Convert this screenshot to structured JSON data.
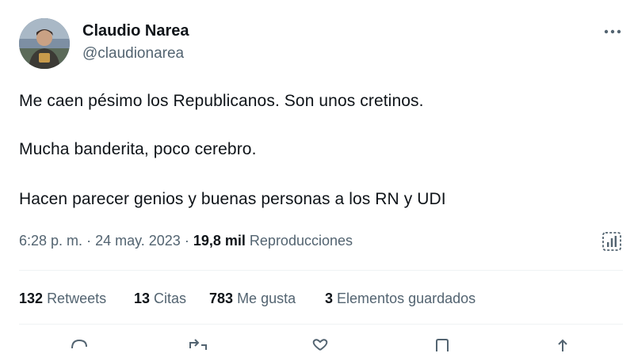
{
  "author": {
    "name": "Claudio Narea",
    "handle": "@claudionarea",
    "avatar_icon": "user-photo-avatar"
  },
  "tweet": {
    "lines": [
      "Me caen pésimo los Republicanos. Son unos cretinos.",
      "Mucha banderita, poco cerebro.",
      "Hacen parecer genios y buenas personas a los RN y UDI"
    ]
  },
  "meta": {
    "time": "6:28 p. m.",
    "separator": "·",
    "date": "24 may. 2023",
    "views_count": "19,8 mil",
    "views_label": "Reproducciones"
  },
  "stats": {
    "retweets_count": "132",
    "retweets_label": "Retweets",
    "quotes_count": "13",
    "quotes_label": "Citas",
    "likes_count": "783",
    "likes_label": "Me gusta",
    "bookmarks_count": "3",
    "bookmarks_label": "Elementos guardados"
  },
  "icons": {
    "more": "more-options-icon",
    "analytics": "analytics-icon",
    "actions": [
      "reply-icon",
      "retweet-icon",
      "like-icon",
      "bookmark-icon",
      "share-icon"
    ]
  },
  "colors": {
    "text": "#0f1419",
    "secondary": "#536471",
    "divider": "#eff3f4"
  }
}
